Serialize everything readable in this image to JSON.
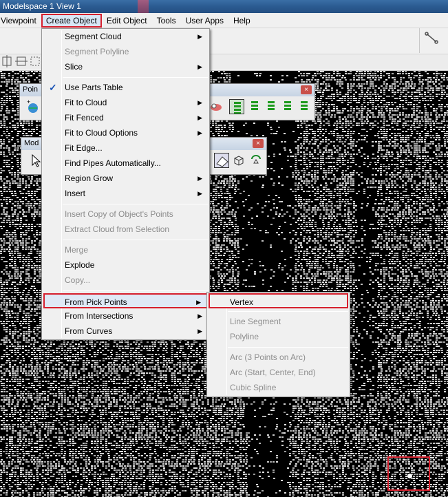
{
  "window": {
    "title": "Modelspace 1 View 1"
  },
  "menubar": {
    "items": [
      {
        "id": "viewpoint",
        "label": "Viewpoint"
      },
      {
        "id": "create-object",
        "label": "Create Object"
      },
      {
        "id": "edit-object",
        "label": "Edit Object"
      },
      {
        "id": "tools",
        "label": "Tools"
      },
      {
        "id": "user-apps",
        "label": "User Apps"
      },
      {
        "id": "help",
        "label": "Help"
      }
    ]
  },
  "floating_toolbars": {
    "points": {
      "title": "Poin",
      "close": "×"
    },
    "modeling": {
      "title": "Mod",
      "close": "×"
    }
  },
  "create_menu": {
    "segment_cloud": "Segment Cloud",
    "segment_polyline": "Segment Polyline",
    "slice": "Slice",
    "use_parts_table": "Use Parts Table",
    "check": "✓",
    "fit_to_cloud": "Fit to Cloud",
    "fit_fenced": "Fit Fenced",
    "fit_to_cloud_options": "Fit to Cloud Options",
    "fit_edge": "Fit Edge...",
    "find_pipes": "Find Pipes Automatically...",
    "region_grow": "Region Grow",
    "insert": "Insert",
    "insert_copy": "Insert Copy of Object's Points",
    "extract_cloud": "Extract Cloud from Selection",
    "merge": "Merge",
    "explode": "Explode",
    "copy": "Copy...",
    "from_pick_points": "From Pick Points",
    "from_intersections": "From Intersections",
    "from_curves": "From Curves",
    "arrow": "▶"
  },
  "submenu": {
    "vertex": "Vertex",
    "line_segment": "Line Segment",
    "polyline": "Polyline",
    "arc_3_points": "Arc (3 Points on Arc)",
    "arc_start_center_end": "Arc (Start, Center, End)",
    "cubic_spline": "Cubic Spline"
  },
  "colors": {
    "highlight_border": "#d61f2d",
    "menu_bg": "#f0f0f0",
    "disabled_text": "#8d8d8d",
    "check": "#1f57b7"
  }
}
